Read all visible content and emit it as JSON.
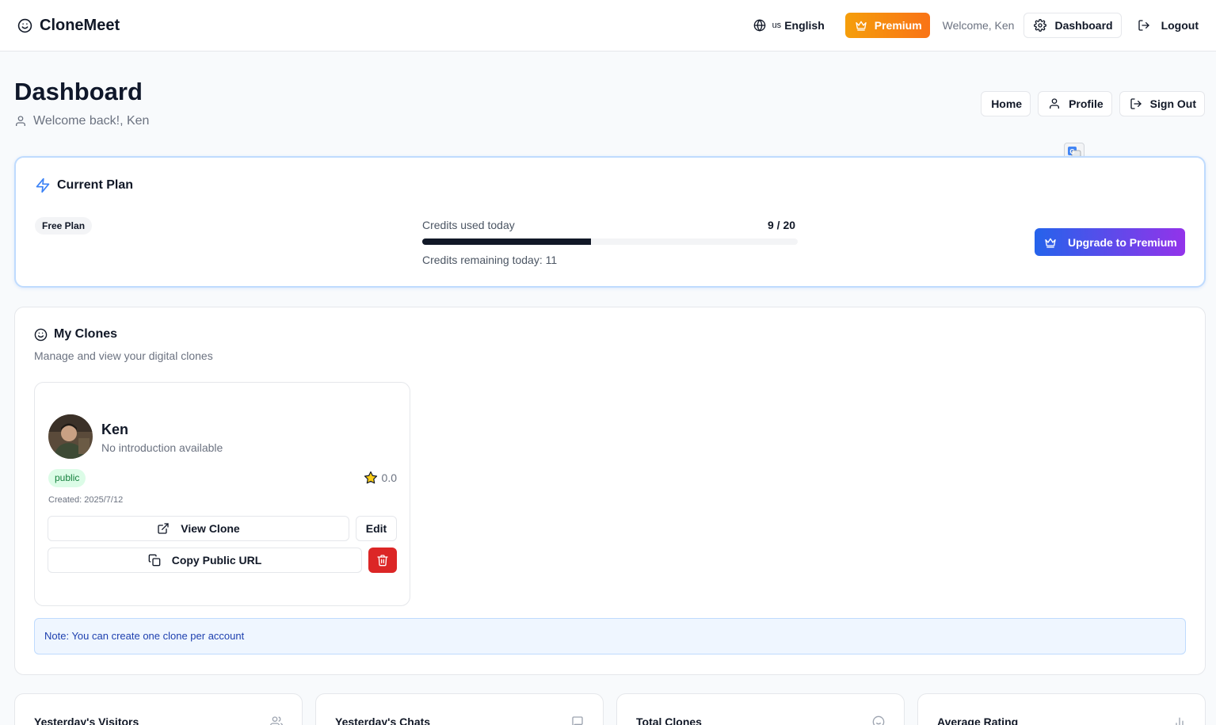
{
  "app": {
    "name": "CloneMeet"
  },
  "topbar": {
    "lang_code": "us",
    "lang_label": "English",
    "premium_label": "Premium",
    "welcome": "Welcome, Ken",
    "dashboard_label": "Dashboard",
    "logout_label": "Logout"
  },
  "page": {
    "title": "Dashboard",
    "subtitle": "Welcome back!, Ken",
    "actions": {
      "home": "Home",
      "profile": "Profile",
      "signout": "Sign Out"
    }
  },
  "plan": {
    "title": "Current Plan",
    "badge": "Free Plan",
    "credits_label": "Credits used today",
    "credits_value": "9 / 20",
    "credits_used": 9,
    "credits_total": 20,
    "credits_remaining": "Credits remaining today: 11",
    "upgrade_label": "Upgrade to Premium"
  },
  "clones": {
    "title": "My Clones",
    "subtitle": "Manage and view your digital clones",
    "items": [
      {
        "name": "Ken",
        "intro": "No introduction available",
        "visibility": "public",
        "rating": "0.0",
        "created": "Created: 2025/7/12",
        "view_label": "View Clone",
        "edit_label": "Edit",
        "copy_label": "Copy Public URL"
      }
    ],
    "note": "Note: You can create one clone per account"
  },
  "stats": [
    {
      "label": "Yesterday's Visitors",
      "icon": "users-icon"
    },
    {
      "label": "Yesterday's Chats",
      "icon": "message-icon"
    },
    {
      "label": "Total Clones",
      "icon": "smile-icon"
    },
    {
      "label": "Average Rating",
      "icon": "bar-chart-icon"
    }
  ],
  "colors": {
    "premium_gradient": [
      "#f59e0b",
      "#f97316"
    ],
    "upgrade_gradient": [
      "#2563eb",
      "#9333ea"
    ],
    "danger": "#dc2626",
    "progress": "#111827",
    "public_badge_bg": "#dcfce7",
    "note_bg": "#eff6ff"
  }
}
